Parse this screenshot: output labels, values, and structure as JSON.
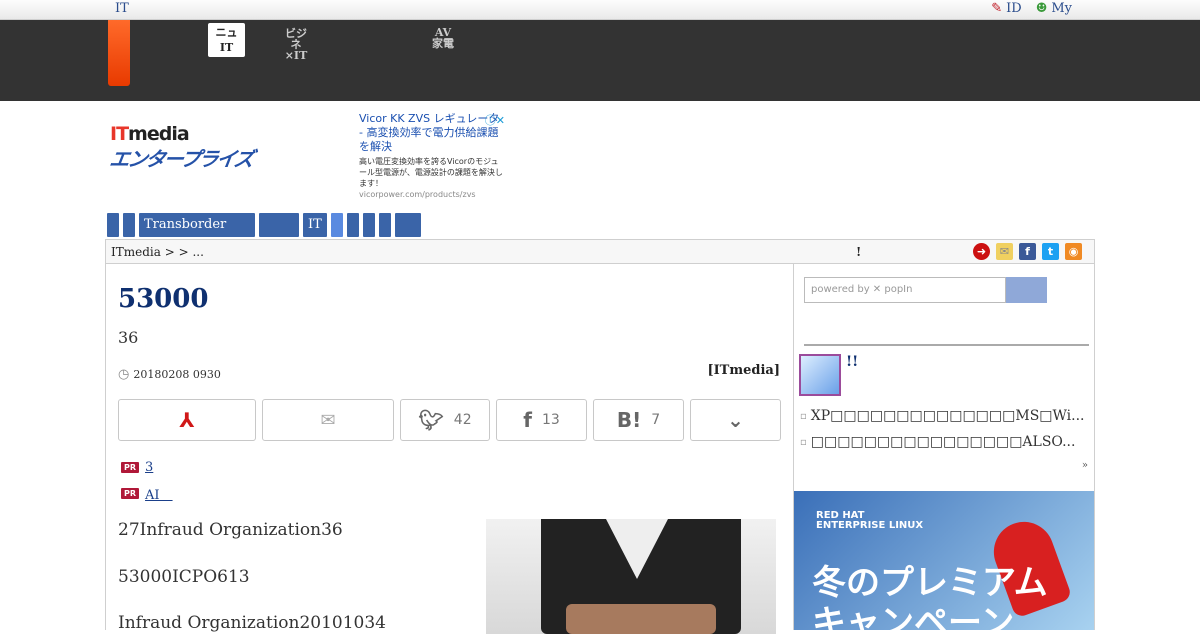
{
  "topstrip": {
    "left": "IT",
    "id_link": "ID",
    "my_link": "My"
  },
  "globalnav": {
    "tab1_line1": "ニュ",
    "tab1_line2": "IT",
    "tab2_line1": "ビジネ",
    "tab2_line2": "×IT",
    "tab3_line1": "AV",
    "tab3_line2": "家電"
  },
  "logo": {
    "top": "ITmedia",
    "bottom": "エンタープライズ"
  },
  "ad": {
    "title": "Vicor KK ZVS レギュレータ - 高変換効率で電力供給課題を解決",
    "desc": "高い電圧変換効率を誇るVicorのモジュール型電源が、電源設計の課題を解決します！",
    "url": "vicorpower.com/products/zvs"
  },
  "catnav": [
    "",
    "",
    "Transborder",
    "",
    "IT",
    "",
    "",
    "",
    "",
    ""
  ],
  "breadcrumb": {
    "text": "ITmedia  >  > ...",
    "mark": "!"
  },
  "article": {
    "title": "53000",
    "subtitle": "36",
    "date": "20180208 0930",
    "source": "[ITmedia]",
    "share": {
      "twitter_count": "42",
      "facebook_count": "13",
      "hatena_count": "7"
    },
    "pr_links": [
      "3",
      "AI　"
    ],
    "paragraphs": [
      "27Infraud Organization36",
      "53000ICPO613",
      "Infraud Organization20101034"
    ]
  },
  "sidebar": {
    "search_placeholder": "powered by ✕ popIn",
    "mail_title": "!!",
    "items": [
      "XP□□□□□□□□□□□□□□MS□Wi...",
      "□□□□□□□□□□□□□□□□ALSO..."
    ],
    "more": "»",
    "banner": {
      "brand1": "RED HAT",
      "brand2": "ENTERPRISE LINUX",
      "text": "冬のプレミアム\nキャンペーン"
    }
  }
}
